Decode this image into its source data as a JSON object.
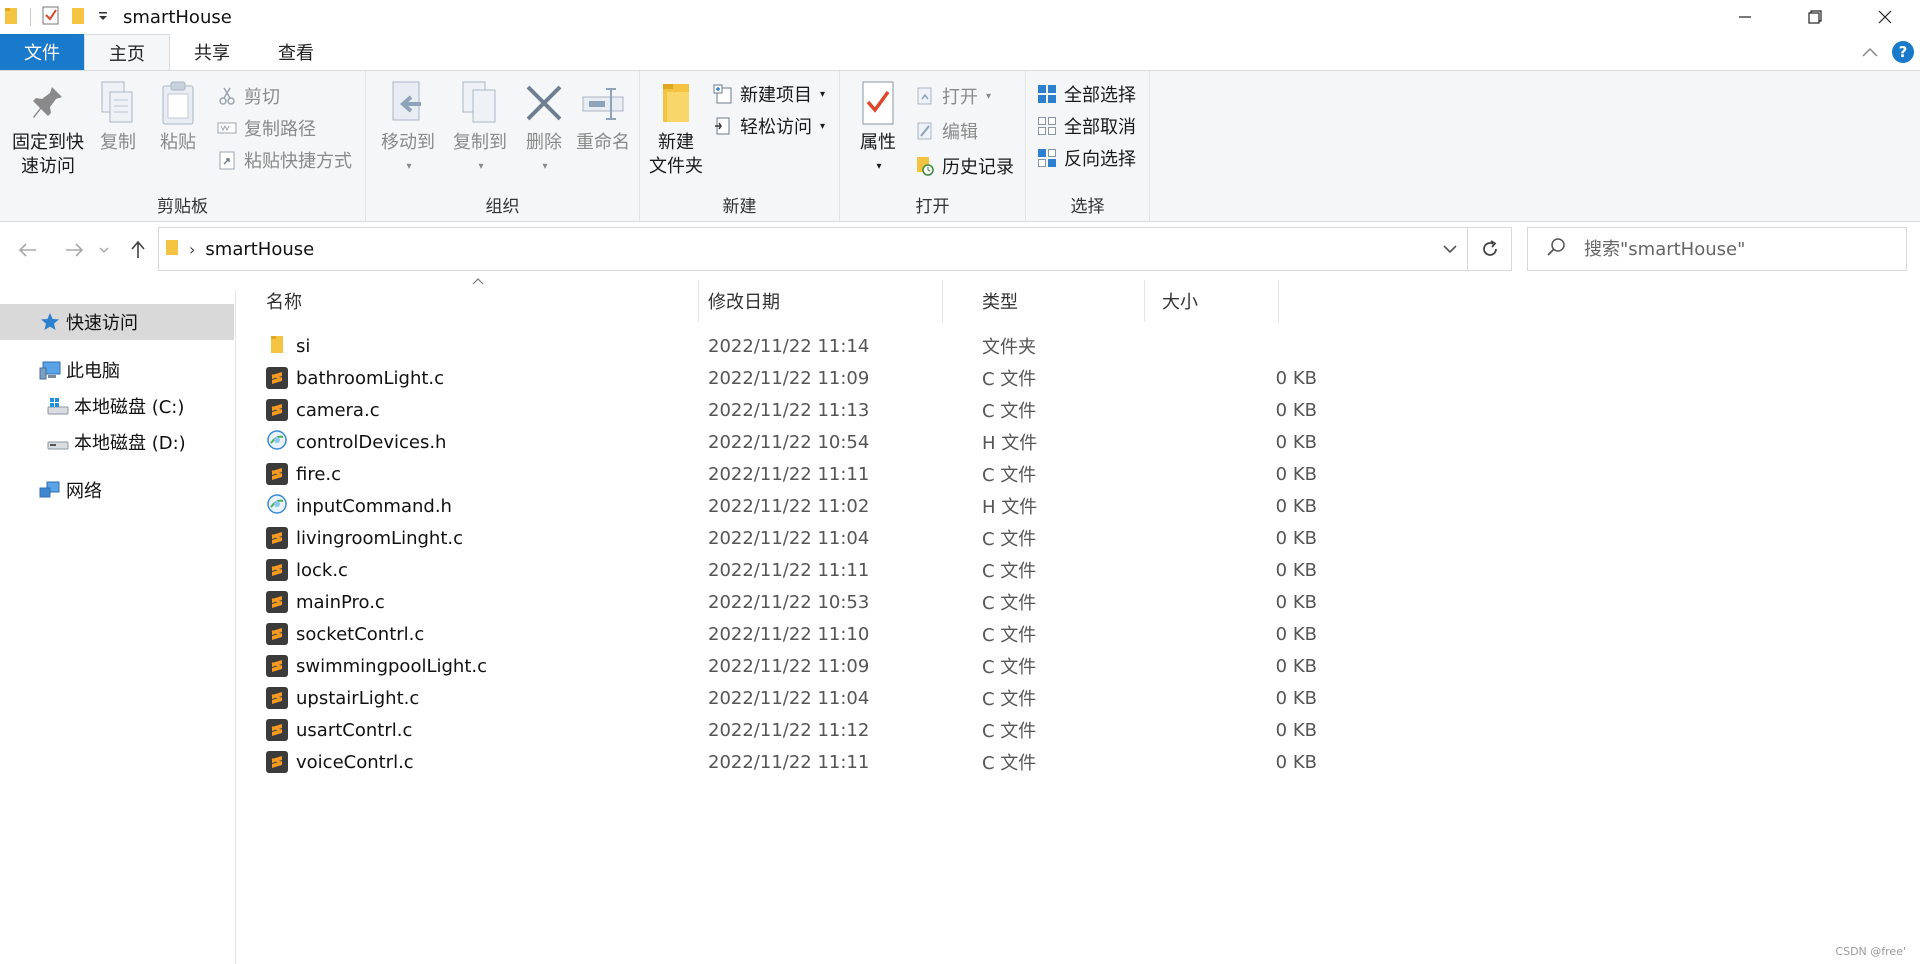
{
  "window": {
    "title": "smartHouse"
  },
  "tabs": {
    "file": "文件",
    "home": "主页",
    "share": "共享",
    "view": "查看",
    "help": "?"
  },
  "ribbon": {
    "clipboard": {
      "label": "剪贴板",
      "pin_line1": "固定到快",
      "pin_line2": "速访问",
      "copy": "复制",
      "paste": "粘贴",
      "cut": "剪切",
      "copy_path": "复制路径",
      "paste_shortcut": "粘贴快捷方式"
    },
    "organize": {
      "label": "组织",
      "move_to": "移动到",
      "copy_to": "复制到",
      "delete": "删除",
      "rename": "重命名"
    },
    "new": {
      "label": "新建",
      "new_folder_line1": "新建",
      "new_folder_line2": "文件夹",
      "new_item": "新建项目",
      "easy_access": "轻松访问"
    },
    "open": {
      "label": "打开",
      "properties": "属性",
      "open": "打开",
      "edit": "编辑",
      "history": "历史记录"
    },
    "select": {
      "label": "选择",
      "select_all": "全部选择",
      "select_none": "全部取消",
      "invert": "反向选择"
    }
  },
  "address": {
    "path": "smartHouse",
    "search_placeholder": "搜索\"smartHouse\""
  },
  "nav": {
    "quick_access": "快速访问",
    "this_pc": "此电脑",
    "drive_c": "本地磁盘 (C:)",
    "drive_d": "本地磁盘 (D:)",
    "network": "网络"
  },
  "columns": {
    "name": "名称",
    "date": "修改日期",
    "type": "类型",
    "size": "大小"
  },
  "files": [
    {
      "name": "si",
      "date": "2022/11/22 11:14",
      "type": "文件夹",
      "size": "",
      "icon": "folder-icon"
    },
    {
      "name": "bathroomLight.c",
      "date": "2022/11/22 11:09",
      "type": "C 文件",
      "size": "0 KB",
      "icon": "c-file-icon"
    },
    {
      "name": "camera.c",
      "date": "2022/11/22 11:13",
      "type": "C 文件",
      "size": "0 KB",
      "icon": "c-file-icon"
    },
    {
      "name": "controlDevices.h",
      "date": "2022/11/22 10:54",
      "type": "H 文件",
      "size": "0 KB",
      "icon": "h-file-icon"
    },
    {
      "name": "fire.c",
      "date": "2022/11/22 11:11",
      "type": "C 文件",
      "size": "0 KB",
      "icon": "c-file-icon"
    },
    {
      "name": "inputCommand.h",
      "date": "2022/11/22 11:02",
      "type": "H 文件",
      "size": "0 KB",
      "icon": "h-file-icon"
    },
    {
      "name": "livingroomLinght.c",
      "date": "2022/11/22 11:04",
      "type": "C 文件",
      "size": "0 KB",
      "icon": "c-file-icon"
    },
    {
      "name": "lock.c",
      "date": "2022/11/22 11:11",
      "type": "C 文件",
      "size": "0 KB",
      "icon": "c-file-icon"
    },
    {
      "name": "mainPro.c",
      "date": "2022/11/22 10:53",
      "type": "C 文件",
      "size": "0 KB",
      "icon": "c-file-icon"
    },
    {
      "name": "socketContrl.c",
      "date": "2022/11/22 11:10",
      "type": "C 文件",
      "size": "0 KB",
      "icon": "c-file-icon"
    },
    {
      "name": "swimmingpoolLight.c",
      "date": "2022/11/22 11:09",
      "type": "C 文件",
      "size": "0 KB",
      "icon": "c-file-icon"
    },
    {
      "name": "upstairLight.c",
      "date": "2022/11/22 11:04",
      "type": "C 文件",
      "size": "0 KB",
      "icon": "c-file-icon"
    },
    {
      "name": "usartContrl.c",
      "date": "2022/11/22 11:12",
      "type": "C 文件",
      "size": "0 KB",
      "icon": "c-file-icon"
    },
    {
      "name": "voiceContrl.c",
      "date": "2022/11/22 11:11",
      "type": "C 文件",
      "size": "0 KB",
      "icon": "c-file-icon"
    }
  ],
  "watermark": "CSDN @free'",
  "colors": {
    "accent": "#1979ca",
    "folder": "#f5c342",
    "sublime_bg": "#3b3b3b",
    "sublime_fg": "#f59a23"
  }
}
